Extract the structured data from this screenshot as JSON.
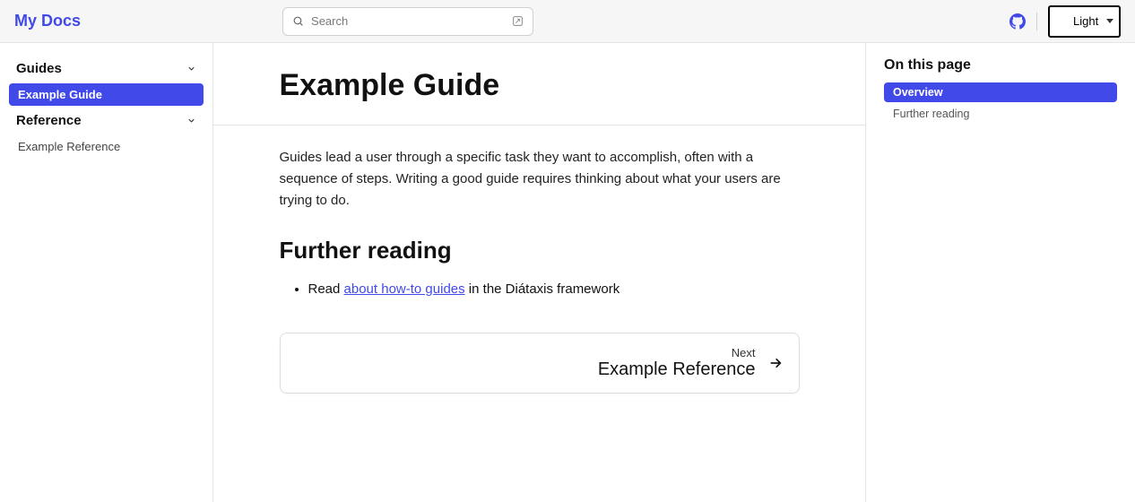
{
  "header": {
    "site_title": "My Docs",
    "search_placeholder": "Search",
    "theme_selected": "Light"
  },
  "sidebar": {
    "groups": [
      {
        "label": "Guides",
        "items": [
          {
            "label": "Example Guide",
            "active": true
          }
        ]
      },
      {
        "label": "Reference",
        "items": [
          {
            "label": "Example Reference",
            "active": false
          }
        ]
      }
    ]
  },
  "page": {
    "title": "Example Guide",
    "intro": "Guides lead a user through a specific task they want to accomplish, often with a sequence of steps. Writing a good guide requires thinking about what your users are trying to do.",
    "section_heading": "Further reading",
    "bullet_prefix": "Read ",
    "bullet_link": "about how-to guides",
    "bullet_suffix": " in the Diátaxis framework",
    "next_label": "Next",
    "next_title": "Example Reference"
  },
  "toc": {
    "title": "On this page",
    "items": [
      {
        "label": "Overview",
        "active": true
      },
      {
        "label": "Further reading",
        "active": false
      }
    ]
  }
}
